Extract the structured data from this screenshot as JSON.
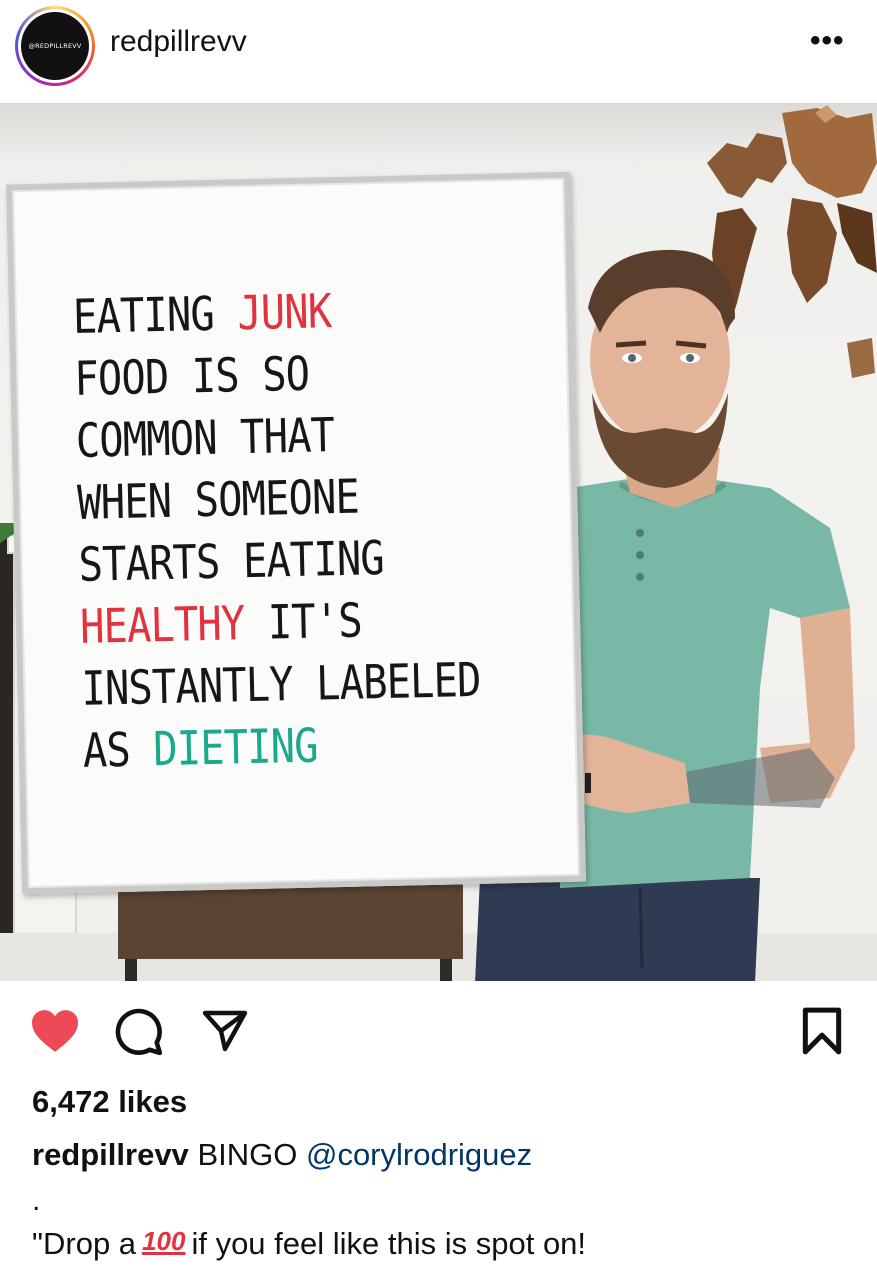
{
  "header": {
    "username": "redpillrevv",
    "avatar_text": "@REDPILLREVV",
    "more_label": "•••"
  },
  "post": {
    "board_lines": [
      [
        {
          "text": "EATING ",
          "color": "black"
        },
        {
          "text": "JUNK",
          "color": "red"
        }
      ],
      [
        {
          "text": "FOOD IS SO",
          "color": "black"
        }
      ],
      [
        {
          "text": "COMMON THAT",
          "color": "black"
        }
      ],
      [
        {
          "text": "WHEN SOMEONE",
          "color": "black"
        }
      ],
      [
        {
          "text": "STARTS EATING",
          "color": "black"
        }
      ],
      [
        {
          "text": "HEALTHY",
          "color": "red"
        },
        {
          "text": " IT'S",
          "color": "black"
        }
      ],
      [
        {
          "text": "INSTANTLY LABELED",
          "color": "black"
        }
      ],
      [
        {
          "text": "AS ",
          "color": "black"
        },
        {
          "text": "DIETING",
          "color": "green"
        }
      ]
    ]
  },
  "actions": {
    "like_icon": "heart-filled-icon",
    "comment_icon": "comment-bubble-icon",
    "share_icon": "paper-plane-icon",
    "save_icon": "bookmark-icon",
    "like_color": "#ed4956"
  },
  "likes": "6,472 likes",
  "caption": {
    "username": "redpillrevv",
    "text": "BINGO",
    "mention": "@corylrodriguez",
    "dot": ".",
    "quote_before": "\"Drop a",
    "emoji": "100",
    "quote_after": "if you feel like this is spot on!"
  }
}
